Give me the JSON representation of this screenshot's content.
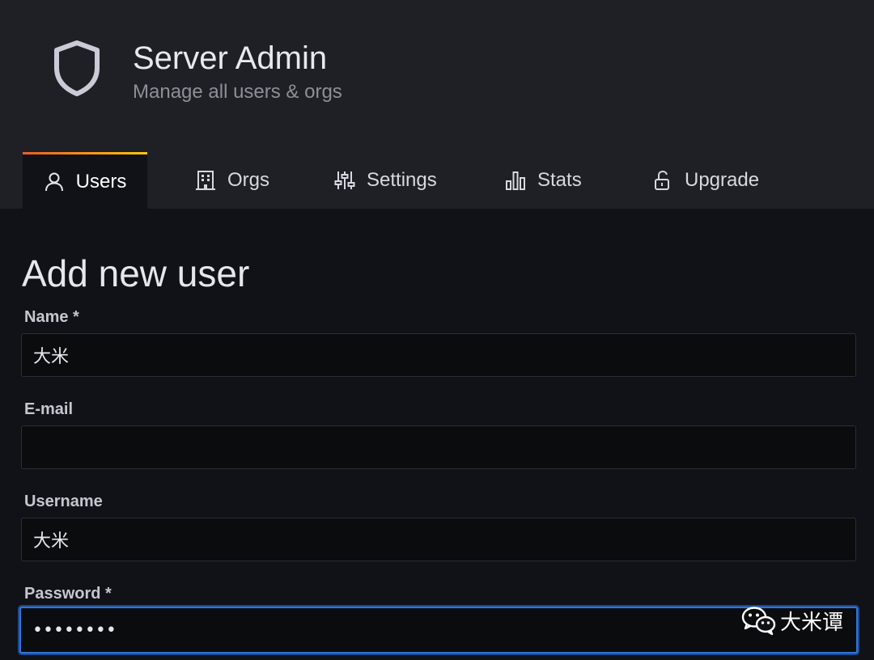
{
  "header": {
    "title": "Server Admin",
    "subtitle": "Manage all users & orgs",
    "icon": "shield-icon"
  },
  "tabs": [
    {
      "label": "Users",
      "icon": "user-icon",
      "active": true
    },
    {
      "label": "Orgs",
      "icon": "building-icon",
      "active": false
    },
    {
      "label": "Settings",
      "icon": "sliders-icon",
      "active": false
    },
    {
      "label": "Stats",
      "icon": "bar-chart-icon",
      "active": false
    },
    {
      "label": "Upgrade",
      "icon": "unlock-icon",
      "active": false
    }
  ],
  "form": {
    "heading": "Add new user",
    "fields": {
      "name": {
        "label": "Name *",
        "value": "大米"
      },
      "email": {
        "label": "E-mail",
        "value": ""
      },
      "username": {
        "label": "Username",
        "value": "大米"
      },
      "password": {
        "label": "Password *",
        "value": "••••••••"
      }
    }
  },
  "watermark": {
    "text": "大米谭",
    "icon": "wechat-icon"
  },
  "colors": {
    "background": "#111217",
    "header_bg": "#1f2026",
    "input_bg": "#0b0c0e",
    "focus": "#3274d9",
    "tab_accent_start": "#f05a28",
    "tab_accent_end": "#fbca0a"
  }
}
